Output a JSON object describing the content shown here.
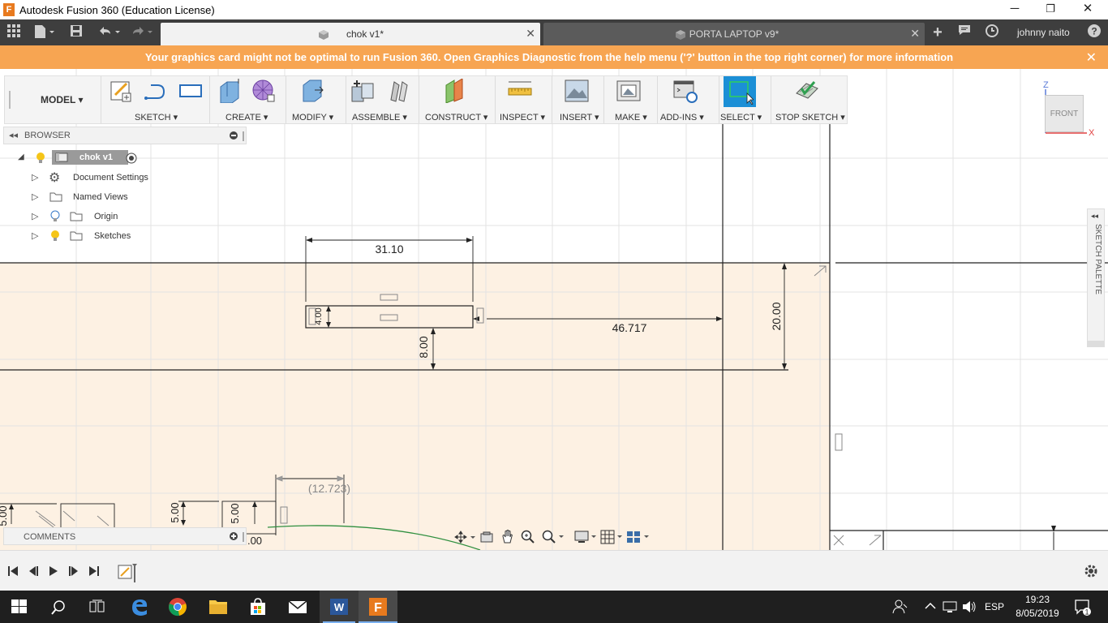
{
  "window": {
    "title": "Autodesk Fusion 360 (Education License)",
    "logo_letter": "F",
    "minimize": "─",
    "restore": "❐",
    "close": "✕"
  },
  "tabs": [
    {
      "label": "chok v1*",
      "close": "✕",
      "active": true
    },
    {
      "label": "PORTA LAPTOP v9*",
      "close": "✕",
      "active": false
    }
  ],
  "tabbar": {
    "user": "johnny naito",
    "new_tab": "+",
    "help": "?"
  },
  "banner": {
    "text": "Your graphics card might not be optimal to run Fusion 360. Open Graphics Diagnostic from the help menu ('?' button in the top right corner) for more information",
    "close": "✕"
  },
  "toolbar": {
    "workspace": "MODEL ▾",
    "groups": [
      "SKETCH ▾",
      "CREATE ▾",
      "MODIFY ▾",
      "ASSEMBLE ▾",
      "CONSTRUCT ▾",
      "INSPECT ▾",
      "INSERT ▾",
      "MAKE ▾",
      "ADD-INS ▾",
      "SELECT ▾",
      "STOP SKETCH ▾"
    ]
  },
  "browser": {
    "title": "BROWSER",
    "root": "chok v1",
    "items": [
      "Document Settings",
      "Named Views",
      "Origin",
      "Sketches"
    ]
  },
  "comments": {
    "title": "COMMENTS"
  },
  "viewcube": {
    "face": "FRONT",
    "axis_z": "Z",
    "axis_x": "X"
  },
  "sketch_palette": {
    "label": "SKETCH PALETTE"
  },
  "dimensions": {
    "width": "31.10",
    "offset": "46.717",
    "height": "20.00",
    "gap": "8.00",
    "small": "4.00",
    "ref": "(12.723)",
    "left_a": "5.00",
    "left_b": "5.00",
    "left_c": "5.00",
    "bottom": ".00"
  },
  "taskbar": {
    "lang": "ESP",
    "time": "19:23",
    "date": "8/05/2019",
    "notif_count": "1"
  },
  "colors": {
    "banner": "#f7a552",
    "sketch_fill": "#fdf1e3",
    "select_active": "#1b8fd6",
    "taskbar": "#1f1f1f"
  }
}
